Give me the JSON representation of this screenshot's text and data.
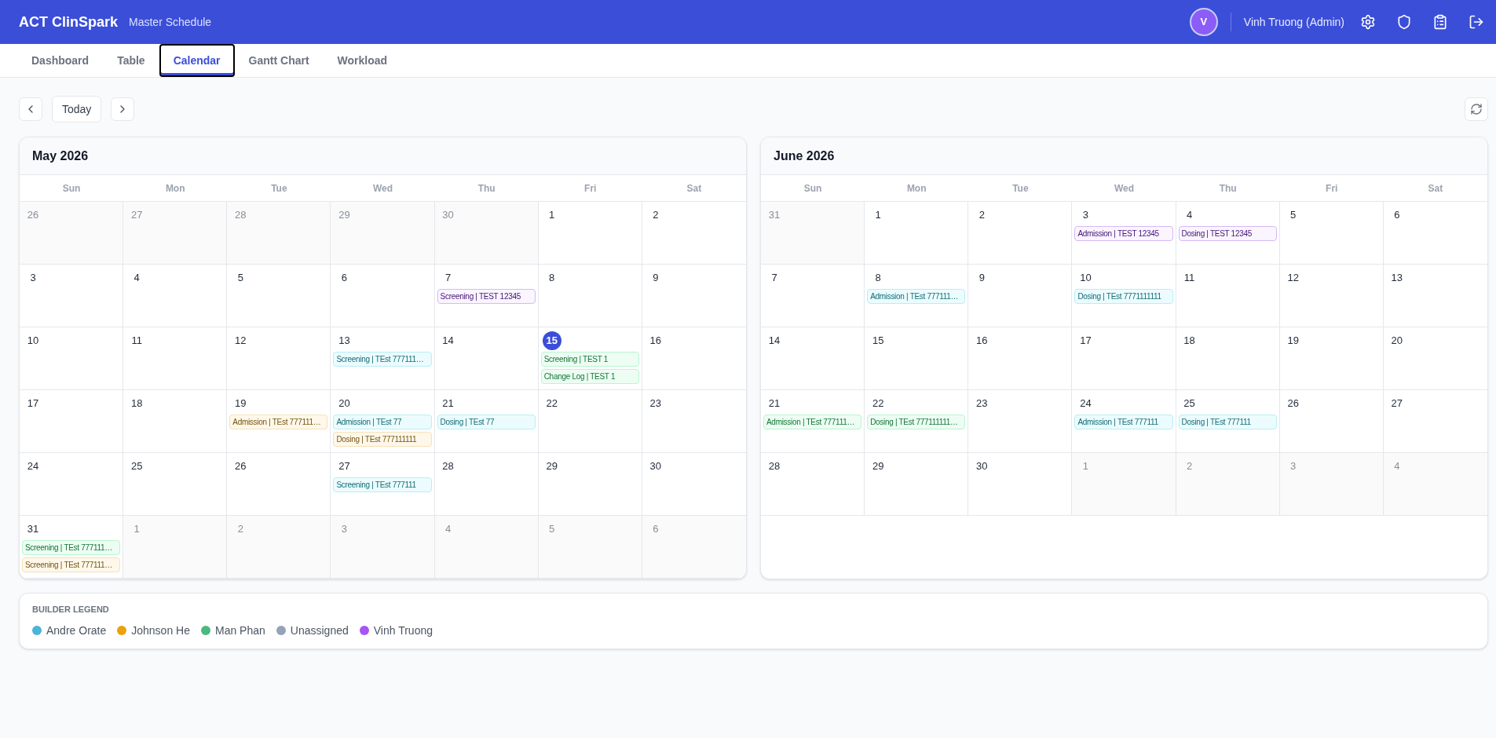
{
  "app": {
    "title": "ACT ClinSpark",
    "subtitle": "Master Schedule"
  },
  "user": {
    "avatar_initial": "V",
    "name": "Vinh Truong (Admin)"
  },
  "tabs": [
    {
      "label": "Dashboard",
      "selected": false
    },
    {
      "label": "Table",
      "selected": false
    },
    {
      "label": "Calendar",
      "selected": true
    },
    {
      "label": "Gantt Chart",
      "selected": false
    },
    {
      "label": "Workload",
      "selected": false
    }
  ],
  "toolbar": {
    "today_label": "Today"
  },
  "calendars": [
    {
      "title": "May 2026",
      "weekdays": [
        "Sun",
        "Mon",
        "Tue",
        "Wed",
        "Thu",
        "Fri",
        "Sat"
      ],
      "weeks": [
        [
          {
            "day": "26",
            "outside": true,
            "today": false
          },
          {
            "day": "27",
            "outside": true,
            "today": false
          },
          {
            "day": "28",
            "outside": true,
            "today": false
          },
          {
            "day": "29",
            "outside": true,
            "today": false
          },
          {
            "day": "30",
            "outside": true,
            "today": false
          },
          {
            "day": "1",
            "outside": false,
            "today": false
          },
          {
            "day": "2",
            "outside": false,
            "today": false
          }
        ],
        [
          {
            "day": "3",
            "outside": false,
            "today": false
          },
          {
            "day": "4",
            "outside": false,
            "today": false
          },
          {
            "day": "5",
            "outside": false,
            "today": false
          },
          {
            "day": "6",
            "outside": false,
            "today": false
          },
          {
            "day": "7",
            "outside": false,
            "today": false,
            "events": [
              {
                "label": "Screening | TEST 12345",
                "color": "#faf5ff"
              }
            ]
          },
          {
            "day": "8",
            "outside": false,
            "today": false
          },
          {
            "day": "9",
            "outside": false,
            "today": false
          }
        ],
        [
          {
            "day": "10",
            "outside": false,
            "today": false
          },
          {
            "day": "11",
            "outside": false,
            "today": false
          },
          {
            "day": "12",
            "outside": false,
            "today": false
          },
          {
            "day": "13",
            "outside": false,
            "today": false,
            "events": [
              {
                "label": "Screening | TEst 777111…",
                "color": "#ecfcfe"
              }
            ]
          },
          {
            "day": "14",
            "outside": false,
            "today": false
          },
          {
            "day": "15",
            "outside": false,
            "today": true,
            "events": [
              {
                "label": "Screening | TEST 1",
                "color": "#edfdf3"
              },
              {
                "label": "Change Log | TEST 1",
                "color": "#edfdf3"
              }
            ]
          },
          {
            "day": "16",
            "outside": false,
            "today": false
          }
        ],
        [
          {
            "day": "17",
            "outside": false,
            "today": false
          },
          {
            "day": "18",
            "outside": false,
            "today": false
          },
          {
            "day": "19",
            "outside": false,
            "today": false,
            "events": [
              {
                "label": "Admission | TEst 777111…",
                "color": "#fff8ea"
              }
            ]
          },
          {
            "day": "20",
            "outside": false,
            "today": false,
            "events": [
              {
                "label": "Admission | TEst 77",
                "color": "#ecfcfe"
              },
              {
                "label": "Dosing | TEst 777111111",
                "color": "#fff8ea"
              }
            ]
          },
          {
            "day": "21",
            "outside": false,
            "today": false,
            "events": [
              {
                "label": "Dosing | TEst 77",
                "color": "#ecfcfe"
              }
            ]
          },
          {
            "day": "22",
            "outside": false,
            "today": false
          },
          {
            "day": "23",
            "outside": false,
            "today": false
          }
        ],
        [
          {
            "day": "24",
            "outside": false,
            "today": false
          },
          {
            "day": "25",
            "outside": false,
            "today": false
          },
          {
            "day": "26",
            "outside": false,
            "today": false
          },
          {
            "day": "27",
            "outside": false,
            "today": false,
            "events": [
              {
                "label": "Screening | TEst 777111",
                "color": "#ecfcfe"
              }
            ]
          },
          {
            "day": "28",
            "outside": false,
            "today": false
          },
          {
            "day": "29",
            "outside": false,
            "today": false
          },
          {
            "day": "30",
            "outside": false,
            "today": false
          }
        ],
        [
          {
            "day": "31",
            "outside": false,
            "today": false,
            "events": [
              {
                "label": "Screening | TEst 777111…",
                "color": "#edfdf3"
              },
              {
                "label": "Screening | TEst 777111…",
                "color": "#fff8ea"
              }
            ]
          },
          {
            "day": "1",
            "outside": true,
            "today": false
          },
          {
            "day": "2",
            "outside": true,
            "today": false
          },
          {
            "day": "3",
            "outside": true,
            "today": false
          },
          {
            "day": "4",
            "outside": true,
            "today": false
          },
          {
            "day": "5",
            "outside": true,
            "today": false
          },
          {
            "day": "6",
            "outside": true,
            "today": false
          }
        ]
      ]
    },
    {
      "title": "June 2026",
      "weekdays": [
        "Sun",
        "Mon",
        "Tue",
        "Wed",
        "Thu",
        "Fri",
        "Sat"
      ],
      "weeks": [
        [
          {
            "day": "31",
            "outside": true,
            "today": false
          },
          {
            "day": "1",
            "outside": false,
            "today": false
          },
          {
            "day": "2",
            "outside": false,
            "today": false
          },
          {
            "day": "3",
            "outside": false,
            "today": false,
            "events": [
              {
                "label": "Admission | TEST 12345",
                "color": "#faf5ff"
              }
            ]
          },
          {
            "day": "4",
            "outside": false,
            "today": false,
            "events": [
              {
                "label": "Dosing | TEST 12345",
                "color": "#faf5ff"
              }
            ]
          },
          {
            "day": "5",
            "outside": false,
            "today": false
          },
          {
            "day": "6",
            "outside": false,
            "today": false
          }
        ],
        [
          {
            "day": "7",
            "outside": false,
            "today": false
          },
          {
            "day": "8",
            "outside": false,
            "today": false,
            "events": [
              {
                "label": "Admission | TEst 777111…",
                "color": "#ecfcfe"
              }
            ]
          },
          {
            "day": "9",
            "outside": false,
            "today": false
          },
          {
            "day": "10",
            "outside": false,
            "today": false,
            "events": [
              {
                "label": "Dosing | TEst 7771111111",
                "color": "#ecfcfe"
              }
            ]
          },
          {
            "day": "11",
            "outside": false,
            "today": false
          },
          {
            "day": "12",
            "outside": false,
            "today": false
          },
          {
            "day": "13",
            "outside": false,
            "today": false
          }
        ],
        [
          {
            "day": "14",
            "outside": false,
            "today": false
          },
          {
            "day": "15",
            "outside": false,
            "today": false
          },
          {
            "day": "16",
            "outside": false,
            "today": false
          },
          {
            "day": "17",
            "outside": false,
            "today": false
          },
          {
            "day": "18",
            "outside": false,
            "today": false
          },
          {
            "day": "19",
            "outside": false,
            "today": false
          },
          {
            "day": "20",
            "outside": false,
            "today": false
          }
        ],
        [
          {
            "day": "21",
            "outside": false,
            "today": false,
            "events": [
              {
                "label": "Admission | TEst 777111…",
                "color": "#edfdf3"
              }
            ]
          },
          {
            "day": "22",
            "outside": false,
            "today": false,
            "events": [
              {
                "label": "Dosing | TEst 777111111…",
                "color": "#edfdf3"
              }
            ]
          },
          {
            "day": "23",
            "outside": false,
            "today": false
          },
          {
            "day": "24",
            "outside": false,
            "today": false,
            "events": [
              {
                "label": "Admission | TEst 777111",
                "color": "#ecfcfe"
              }
            ]
          },
          {
            "day": "25",
            "outside": false,
            "today": false,
            "events": [
              {
                "label": "Dosing | TEst 777111",
                "color": "#ecfcfe"
              }
            ]
          },
          {
            "day": "26",
            "outside": false,
            "today": false
          },
          {
            "day": "27",
            "outside": false,
            "today": false
          }
        ],
        [
          {
            "day": "28",
            "outside": false,
            "today": false
          },
          {
            "day": "29",
            "outside": false,
            "today": false
          },
          {
            "day": "30",
            "outside": false,
            "today": false
          },
          {
            "day": "1",
            "outside": true,
            "today": false
          },
          {
            "day": "2",
            "outside": true,
            "today": false
          },
          {
            "day": "3",
            "outside": true,
            "today": false
          },
          {
            "day": "4",
            "outside": true,
            "today": false
          }
        ]
      ]
    }
  ],
  "legend": {
    "title": "BUILDER LEGEND",
    "items": [
      {
        "name": "Andre Orate",
        "color": "#4bb4d8"
      },
      {
        "name": "Johnson He",
        "color": "#eba10a"
      },
      {
        "name": "Man Phan",
        "color": "#4bb880"
      },
      {
        "name": "Unassigned",
        "color": "#94a3b8"
      },
      {
        "name": "Vinh Truong",
        "color": "#a855f7"
      }
    ]
  }
}
